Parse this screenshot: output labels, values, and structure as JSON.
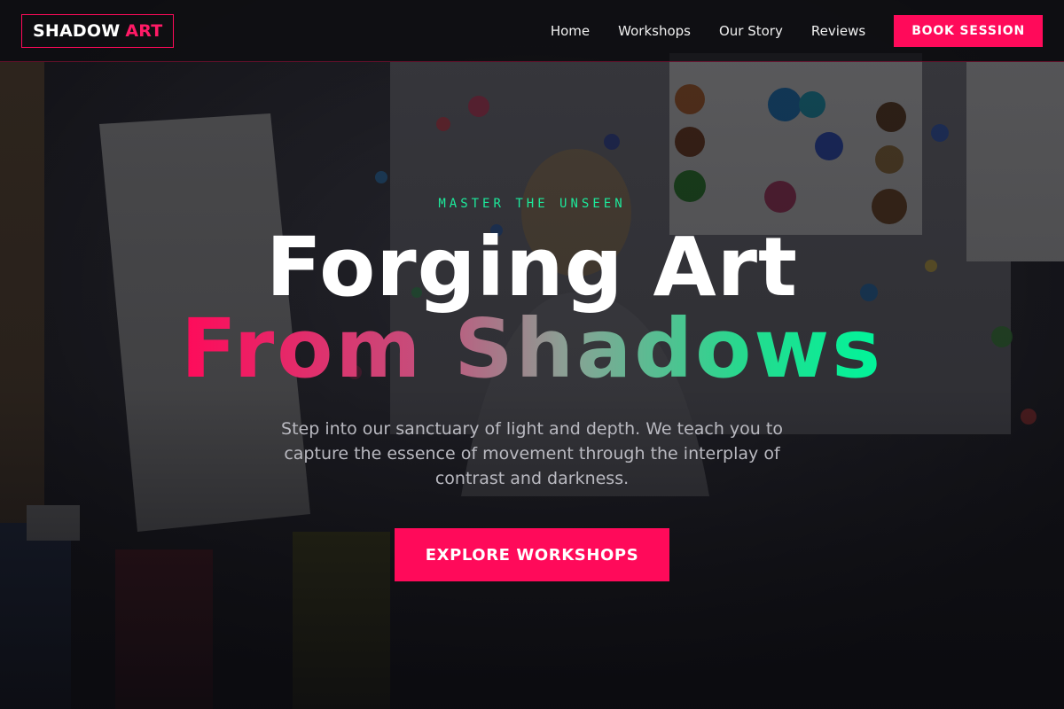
{
  "brand": {
    "word1": "SHADOW",
    "word2": "ART"
  },
  "nav": {
    "links": [
      "Home",
      "Workshops",
      "Our Story",
      "Reviews"
    ],
    "cta": "BOOK SESSION"
  },
  "hero": {
    "eyebrow": "MASTER THE UNSEEN",
    "title_line1": "Forging Art",
    "title_line2": "From Shadows",
    "subtitle": "Step into our sanctuary of light and depth. We teach you to capture the essence of movement through the interplay of contrast and darkness.",
    "cta": "EXPLORE WORKSHOPS"
  },
  "colors": {
    "accent": "#ff0a5a",
    "accent_green": "#1de99b",
    "background": "#0d0d10"
  }
}
